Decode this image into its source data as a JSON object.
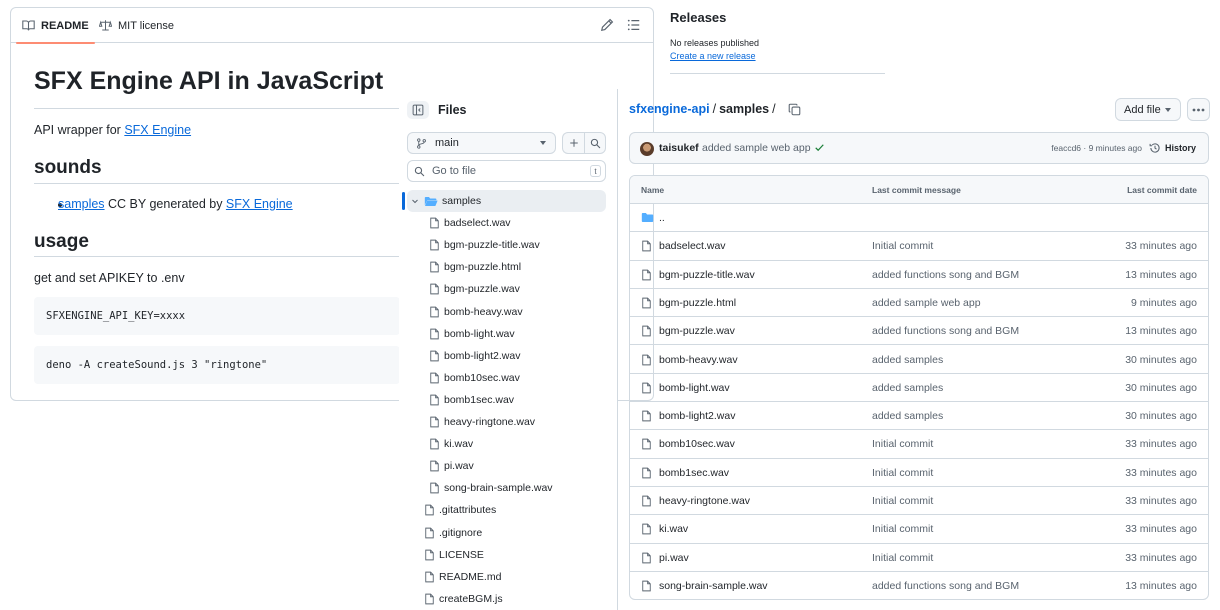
{
  "readme": {
    "tabs": [
      {
        "label": "README",
        "icon": "book-icon"
      },
      {
        "label": "MIT license",
        "icon": "law-icon"
      }
    ],
    "title": "SFX Engine API in JavaScript",
    "intro_text": "API wrapper for ",
    "intro_link": "SFX Engine",
    "h_sounds": "sounds",
    "bullet_link": "samples",
    "bullet_text": " CC BY generated by ",
    "bullet_link2": "SFX Engine",
    "h_usage": "usage",
    "usage_text": "get and set APIKEY to .env",
    "code1": "SFXENGINE_API_KEY=xxxx",
    "code2": "deno -A createSound.js 3 \"ringtone\""
  },
  "releases": {
    "title": "Releases",
    "none": "No releases published",
    "create": "Create a new release"
  },
  "tree": {
    "title": "Files",
    "branch": "main",
    "goto_placeholder": "Go to file",
    "goto_kbd": "t",
    "items": [
      {
        "label": "samples",
        "type": "folder-open",
        "depth": 0,
        "selected": true
      },
      {
        "label": "badselect.wav",
        "type": "file",
        "depth": 1
      },
      {
        "label": "bgm-puzzle-title.wav",
        "type": "file",
        "depth": 1
      },
      {
        "label": "bgm-puzzle.html",
        "type": "file",
        "depth": 1
      },
      {
        "label": "bgm-puzzle.wav",
        "type": "file",
        "depth": 1
      },
      {
        "label": "bomb-heavy.wav",
        "type": "file",
        "depth": 1
      },
      {
        "label": "bomb-light.wav",
        "type": "file",
        "depth": 1
      },
      {
        "label": "bomb-light2.wav",
        "type": "file",
        "depth": 1
      },
      {
        "label": "bomb10sec.wav",
        "type": "file",
        "depth": 1
      },
      {
        "label": "bomb1sec.wav",
        "type": "file",
        "depth": 1
      },
      {
        "label": "heavy-ringtone.wav",
        "type": "file",
        "depth": 1
      },
      {
        "label": "ki.wav",
        "type": "file",
        "depth": 1
      },
      {
        "label": "pi.wav",
        "type": "file",
        "depth": 1
      },
      {
        "label": "song-brain-sample.wav",
        "type": "file",
        "depth": 1
      },
      {
        "label": ".gitattributes",
        "type": "file",
        "depth": 0
      },
      {
        "label": ".gitignore",
        "type": "file",
        "depth": 0
      },
      {
        "label": "LICENSE",
        "type": "file",
        "depth": 0
      },
      {
        "label": "README.md",
        "type": "file",
        "depth": 0
      },
      {
        "label": "createBGM.js",
        "type": "file",
        "depth": 0
      }
    ]
  },
  "breadcrumb": {
    "repo": "sfxengine-api",
    "sep": "/",
    "current": "samples",
    "trail": "/"
  },
  "toolbar": {
    "add_file": "Add file"
  },
  "latest_commit": {
    "author": "taisukef",
    "message": "added sample web app",
    "sha_time": "feaccd6 · 9 minutes ago",
    "history": "History"
  },
  "table": {
    "headers": {
      "name": "Name",
      "message": "Last commit message",
      "date": "Last commit date"
    },
    "parent": "..",
    "rows": [
      {
        "name": "badselect.wav",
        "message": "Initial commit",
        "date": "33 minutes ago"
      },
      {
        "name": "bgm-puzzle-title.wav",
        "message": "added functions song and BGM",
        "date": "13 minutes ago"
      },
      {
        "name": "bgm-puzzle.html",
        "message": "added sample web app",
        "date": "9 minutes ago"
      },
      {
        "name": "bgm-puzzle.wav",
        "message": "added functions song and BGM",
        "date": "13 minutes ago"
      },
      {
        "name": "bomb-heavy.wav",
        "message": "added samples",
        "date": "30 minutes ago"
      },
      {
        "name": "bomb-light.wav",
        "message": "added samples",
        "date": "30 minutes ago"
      },
      {
        "name": "bomb-light2.wav",
        "message": "added samples",
        "date": "30 minutes ago"
      },
      {
        "name": "bomb10sec.wav",
        "message": "Initial commit",
        "date": "33 minutes ago"
      },
      {
        "name": "bomb1sec.wav",
        "message": "Initial commit",
        "date": "33 minutes ago"
      },
      {
        "name": "heavy-ringtone.wav",
        "message": "Initial commit",
        "date": "33 minutes ago"
      },
      {
        "name": "ki.wav",
        "message": "Initial commit",
        "date": "33 minutes ago"
      },
      {
        "name": "pi.wav",
        "message": "Initial commit",
        "date": "33 minutes ago"
      },
      {
        "name": "song-brain-sample.wav",
        "message": "added functions song and BGM",
        "date": "13 minutes ago"
      }
    ]
  },
  "colors": {
    "accent": "#0969da",
    "tab_underline": "#fd8c73",
    "success": "#1a7f37",
    "folder": "#54aeff"
  }
}
